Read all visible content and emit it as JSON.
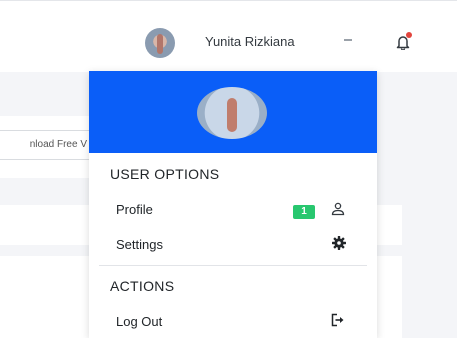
{
  "header": {
    "user_name": "Yunita Rizkiana",
    "bell_icon": "bell-icon",
    "caret_icon": "chevron-down-icon"
  },
  "background": {
    "download_text": "nload Free V"
  },
  "dropdown": {
    "sections": {
      "user_options": "USER OPTIONS",
      "actions": "ACTIONS"
    },
    "items": {
      "profile": {
        "label": "Profile",
        "badge": "1",
        "icon": "user-icon"
      },
      "settings": {
        "label": "Settings",
        "icon": "gear-icon"
      },
      "logout": {
        "label": "Log Out",
        "icon": "sign-out-icon"
      }
    },
    "header_color": "#0a5ef8"
  },
  "colors": {
    "badge": "#28c76f",
    "notification_dot": "#e2453d"
  }
}
